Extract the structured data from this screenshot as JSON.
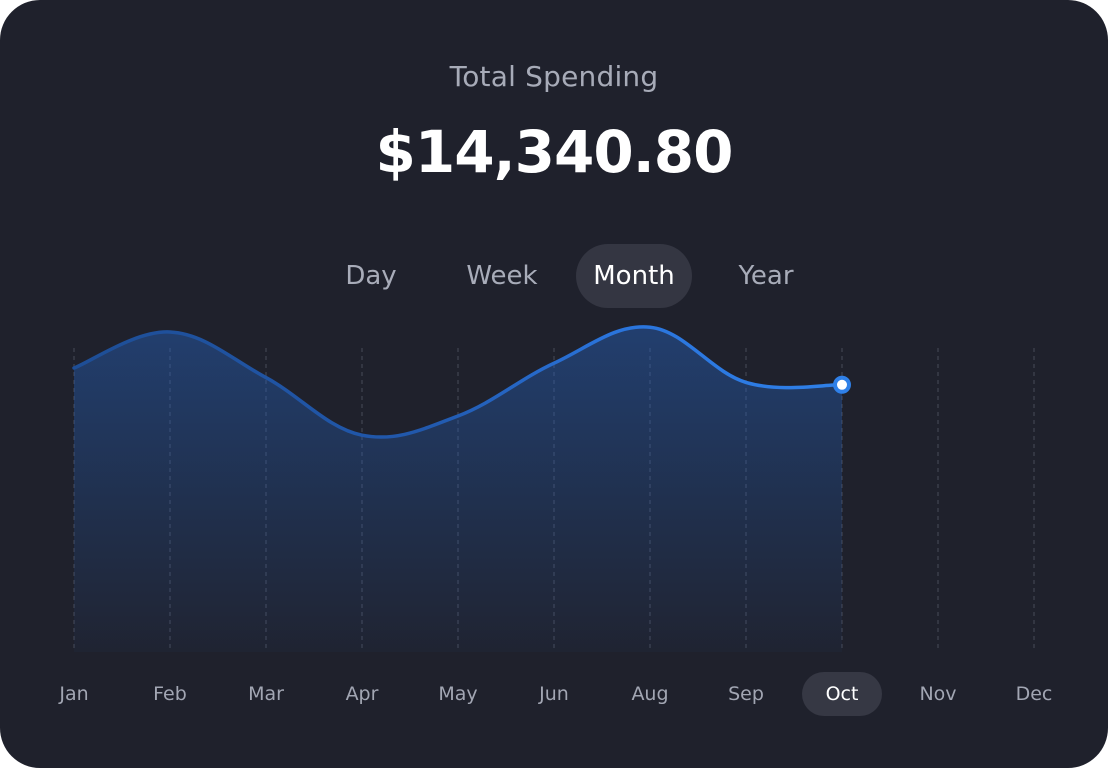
{
  "header": {
    "title": "Total Spending",
    "amount": "$14,340.80"
  },
  "tabs": [
    {
      "label": "Day",
      "active": false
    },
    {
      "label": "Week",
      "active": false
    },
    {
      "label": "Month",
      "active": true
    },
    {
      "label": "Year",
      "active": false
    }
  ],
  "colors": {
    "background": "#1f212c",
    "accent": "#2f80e8",
    "tab_active_bg": "#343642"
  },
  "chart_data": {
    "type": "area",
    "title": "",
    "xlabel": "",
    "ylabel": "",
    "categories": [
      "Jan",
      "Feb",
      "Mar",
      "Apr",
      "May",
      "Jun",
      "Aug",
      "Sep",
      "Oct",
      "Nov",
      "Dec"
    ],
    "values": [
      0.8,
      0.95,
      0.76,
      0.52,
      0.6,
      0.82,
      0.97,
      0.74,
      0.73,
      null,
      null
    ],
    "selected": "Oct",
    "ylim": [
      0,
      1
    ],
    "grid": "vertical dashed",
    "legend": "none"
  }
}
